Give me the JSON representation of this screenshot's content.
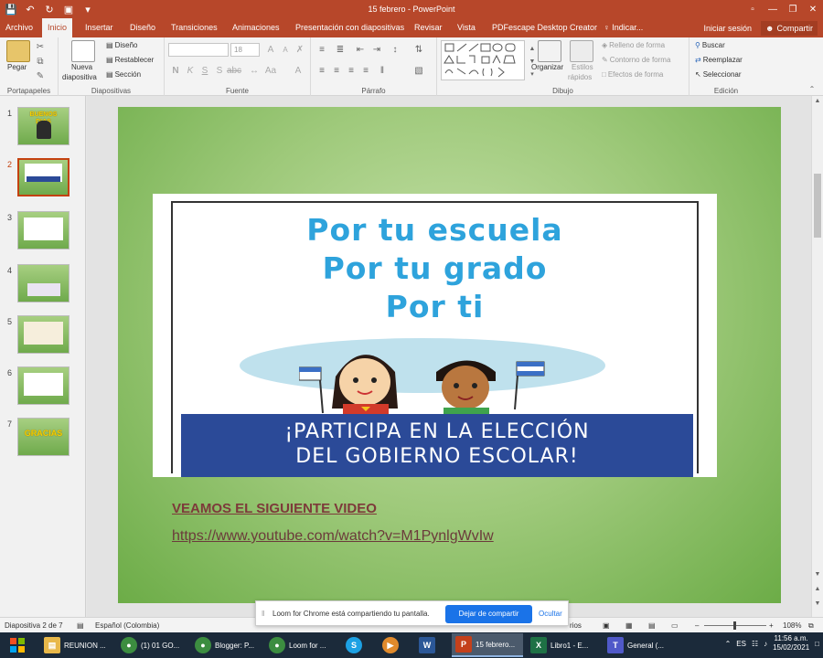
{
  "window": {
    "title": "15 febrero  -  PowerPoint"
  },
  "tabs": [
    "Archivo",
    "Inicio",
    "Insertar",
    "Diseño",
    "Transiciones",
    "Animaciones",
    "Presentación con diapositivas",
    "Revisar",
    "Vista",
    "PDFescape Desktop Creator",
    "♀ Indicar..."
  ],
  "tabs_right": {
    "signin": "Iniciar sesión",
    "share": "Compartir"
  },
  "ribbon": {
    "portapapeles": {
      "paste": "Pegar",
      "label": "Portapapeles"
    },
    "diapositivas": {
      "new_slide": "Nueva",
      "new_slide_2": "diapositiva",
      "layout": "Diseño",
      "reset": "Restablecer",
      "section": "Sección",
      "label": "Diapositivas"
    },
    "fuente": {
      "size": "18",
      "label": "Fuente"
    },
    "parrafo": {
      "label": "Párrafo"
    },
    "dibujo": {
      "organize": "Organizar",
      "styles": "Estilos",
      "styles_2": "rápidos",
      "fill": "Relleno de forma",
      "outline": "Contorno de forma",
      "effects": "Efectos de forma",
      "label": "Dibujo"
    },
    "edicion": {
      "find": "Buscar",
      "replace": "Reemplazar",
      "select": "Seleccionar",
      "label": "Edición"
    }
  },
  "thumbnails": [
    {
      "num": "1",
      "word": "BUENOS DIAS"
    },
    {
      "num": "2",
      "word": ""
    },
    {
      "num": "3",
      "word": ""
    },
    {
      "num": "4",
      "word": ""
    },
    {
      "num": "5",
      "word": ""
    },
    {
      "num": "6",
      "word": ""
    },
    {
      "num": "7",
      "word": "GRACIAS"
    }
  ],
  "slide": {
    "poster_line1": "Por tu escuela",
    "poster_line2": "Por tu grado",
    "poster_line3": "Por ti",
    "banner_line1": "¡PARTICIPA EN LA ELECCIÓN",
    "banner_line2": "DEL GOBIERNO ESCOLAR!",
    "heading": "VEAMOS EL SIGUIENTE VIDEO",
    "link": "https://www.youtube.com/watch?v=M1PynlgWvIw"
  },
  "status": {
    "slide": "Diapositiva 2 de 7",
    "language": "Español (Colombia)",
    "notes": "rios",
    "zoom": "108%"
  },
  "share_bar": {
    "message": "Loom for Chrome está compartiendo tu pantalla.",
    "stop": "Dejar de compartir",
    "hide": "Ocultar"
  },
  "taskbar": {
    "items": [
      {
        "label": "REUNION ...",
        "icon": "folder-icon",
        "color": "#e8b84a"
      },
      {
        "label": "(1) 01 GO...",
        "icon": "chrome-icon",
        "color": "#3c8d40"
      },
      {
        "label": "Blogger: P...",
        "icon": "chrome-icon",
        "color": "#3c8d40"
      },
      {
        "label": "Loom for ...",
        "icon": "chrome-icon",
        "color": "#3c8d40"
      },
      {
        "label": "",
        "icon": "skype-icon",
        "color": "#1da1e4"
      },
      {
        "label": "",
        "icon": "media-icon",
        "color": "#e08a2c"
      },
      {
        "label": "",
        "icon": "word-icon",
        "color": "#2b5797"
      },
      {
        "label": "15 febrero...",
        "icon": "powerpoint-icon",
        "color": "#c4401b"
      },
      {
        "label": "Libro1 - E...",
        "icon": "excel-icon",
        "color": "#1e7145"
      },
      {
        "label": "General (...",
        "icon": "teams-icon",
        "color": "#5059c9"
      }
    ],
    "lang": "ES",
    "time": "11:56 a.m.",
    "date": "15/02/2021"
  },
  "colors": {
    "accent": "#b7472a",
    "slide_green": "#6cac47",
    "banner_blue": "#2b4a98",
    "poster_text": "#2ea3dc"
  }
}
